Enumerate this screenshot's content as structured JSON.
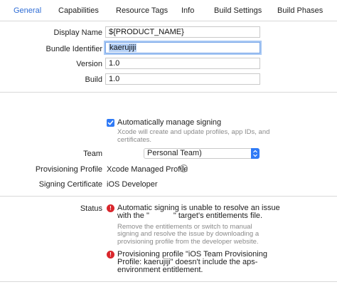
{
  "tabs": [
    "General",
    "Capabilities",
    "Resource Tags",
    "Info",
    "Build Settings",
    "Build Phases"
  ],
  "identity": {
    "display_name": {
      "label": "Display Name",
      "value": "${PRODUCT_NAME}"
    },
    "bundle_identifier": {
      "label": "Bundle Identifier",
      "value": "kaerujiji"
    },
    "version": {
      "label": "Version",
      "value": "1.0"
    },
    "build": {
      "label": "Build",
      "value": "1.0"
    }
  },
  "signing": {
    "auto_manage_label": "Automatically manage signing",
    "auto_manage_checked": true,
    "auto_manage_help_1": "Xcode will create and update profiles, app IDs, and",
    "auto_manage_help_2": "certificates.",
    "team_label": "Team",
    "team_value": "Personal Team)",
    "profile_label": "Provisioning Profile",
    "profile_value": "Xcode Managed Profile",
    "certificate_label": "Signing Certificate",
    "certificate_value": "iOS Developer",
    "status_label": "Status",
    "error1_line1": "Automatic signing is unable to resolve an issue",
    "error1_line2_a": "with the \"",
    "error1_line2_b": "\" target's entitlements file.",
    "error1_help_1": "Remove the entitlements or switch to manual",
    "error1_help_2": "signing and resolve the issue by downloading a",
    "error1_help_3": "provisioning profile from the developer website.",
    "error2_line1": "Provisioning profile \"iOS Team Provisioning",
    "error2_line2": "Profile: kaerujiji\" doesn't include the aps-",
    "error2_line3": "environment entitlement."
  },
  "colors": {
    "accent": "#2f7af6",
    "error": "#d9262c",
    "tab_active": "#2f6dd5"
  }
}
